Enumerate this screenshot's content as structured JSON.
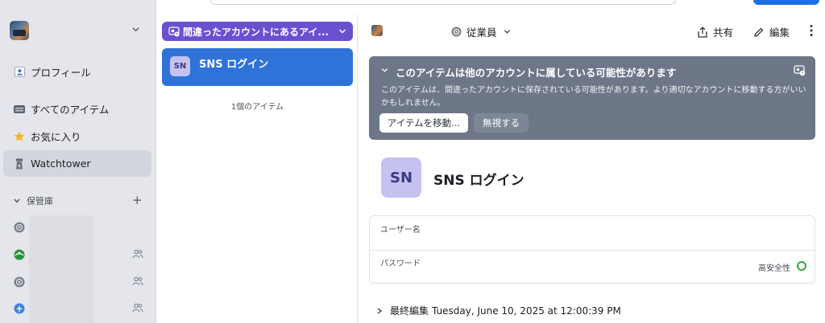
{
  "sidebar": {
    "nav": [
      {
        "label": "プロフィール",
        "icon": "person-icon"
      },
      {
        "label": "すべてのアイテム",
        "icon": "stack-icon"
      },
      {
        "label": "お気に入り",
        "icon": "star-icon"
      },
      {
        "label": "Watchtower",
        "icon": "tower-icon"
      }
    ],
    "section_label": "保管庫",
    "section_add": "+",
    "vaults": [
      {
        "icon": "vault-dial-icon",
        "color": "#7a7f8a",
        "shared": false
      },
      {
        "icon": "vault-green-icon",
        "color": "#2c8f3c",
        "shared": true
      },
      {
        "icon": "vault-dial-icon",
        "color": "#7a7f8a",
        "shared": true
      },
      {
        "icon": "airplane-icon",
        "color": "#3f7fe0",
        "shared": true
      }
    ]
  },
  "list": {
    "filter_label": "間違ったアカウントにあるアイ...",
    "items": [
      {
        "avatar": "SN",
        "title": "SNS ログイン"
      }
    ],
    "count_text": "1個のアイテム"
  },
  "detail": {
    "vault_name": "従業員",
    "share_label": "共有",
    "edit_label": "編集",
    "banner": {
      "title": "このアイテムは他のアカウントに属している可能性があります",
      "body": "このアイテムは、間違ったアカウントに保存されている可能性があります。より適切なアカウントに移動する方がいいかもしれません。",
      "move_button": "アイテムを移動...",
      "ignore_button": "無視する"
    },
    "item_avatar": "SN",
    "item_title": "SNS ログイン",
    "fields": {
      "username_label": "ユーザー名",
      "password_label": "パスワード",
      "strength_label": "高安全性"
    },
    "last_edited_label": "最終編集",
    "last_edited_value": "Tuesday, June 10, 2025 at 12:00:39 PM"
  },
  "colors": {
    "accent": "#2f73d9",
    "filter": "#6b4fd1",
    "banner": "#6e7788",
    "strength": "#39a334"
  }
}
